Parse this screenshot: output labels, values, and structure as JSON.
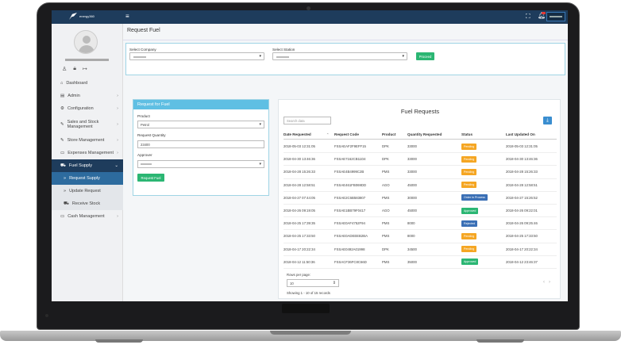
{
  "colors": {
    "topbar": "#1e3c5c",
    "accent_green": "#2bb673",
    "form_header": "#5fbfe3",
    "active_nav": "#2d6b9e"
  },
  "topbar": {
    "brand": "energy360",
    "menu_icon": "hamburger-icon",
    "expand_icon": "expand-icon",
    "bell_icon": "bell-icon"
  },
  "sidebar": {
    "icons": [
      "user-icon",
      "lock-icon",
      "logout-icon"
    ],
    "items": [
      {
        "label": "Dashboard",
        "icon": "home-icon"
      },
      {
        "label": "Admin",
        "icon": "table-icon",
        "chevron": "›"
      },
      {
        "label": "Configuration",
        "icon": "gear-icon",
        "chevron": "›"
      },
      {
        "label": "Sales and Stock Management",
        "icon": "pencil-icon",
        "chevron": "›"
      },
      {
        "label": "Store Management",
        "icon": "pencil-icon",
        "chevron": "›"
      },
      {
        "label": "Expenses Management",
        "icon": "money-icon",
        "chevron": "›"
      },
      {
        "label": "Fuel Supply",
        "icon": "truck-icon",
        "chevron": "⌄"
      },
      {
        "label": "Request Supply",
        "icon": "arrow-icon"
      },
      {
        "label": "Update Request",
        "icon": "arrow-icon"
      },
      {
        "label": "Receive Stock",
        "icon": "truck-icon"
      },
      {
        "label": "Cash Management",
        "icon": "money-icon",
        "chevron": "›"
      }
    ]
  },
  "page": {
    "title": "Request Fuel"
  },
  "selectors": {
    "company_label": "Select Company",
    "station_label": "Select Station",
    "proceed_label": "Proceed"
  },
  "form": {
    "header": "Request for Fuel",
    "product_label": "Product",
    "product_value": "Petrol",
    "quantity_label": "Request Quantity",
    "quantity_value": "23400",
    "approver_label": "Approver",
    "submit_label": "Request Fuel"
  },
  "table": {
    "title": "Fuel Requests",
    "search_placeholder": "Search data",
    "download_icon": "download-icon",
    "headers": [
      "Date Requested",
      "Request Code",
      "Product",
      "Quantity Requested",
      "Status",
      "Last Updated On"
    ],
    "rows": [
      [
        "2018-05-03 12:31:05",
        "FSSAEAF2F9EFF15",
        "DPK",
        "33000",
        "Pending",
        "2018-05-03 12:31:05"
      ],
      [
        "2018-04-30 13:46:36",
        "FSSAE7162CB11D4",
        "DPK",
        "33000",
        "Pending",
        "2018-04-30 13:46:36"
      ],
      [
        "2018-04-28 15:26:33",
        "FSSAE4B4999C2B",
        "PMS",
        "33000",
        "Pending",
        "2018-04-28 15:26:33"
      ],
      [
        "2018-04-28 12:58:51",
        "FSSAE461FB069DD",
        "AGO",
        "45000",
        "Pending",
        "2018-04-28 12:58:51"
      ],
      [
        "2018-04-27 07:44:05",
        "FSSAE2C6B583807",
        "PMS",
        "30000",
        "Order in Process",
        "2018-04-27 15:26:52"
      ],
      [
        "2018-04-26 09:19:05",
        "FSSAE1BB79F0417",
        "AGO",
        "45000",
        "Approved",
        "2018-04-26 09:22:01"
      ],
      [
        "2018-04-25 17:39:35",
        "FSSAE0AF4752F94",
        "PMS",
        "8000",
        "Rejected",
        "2018-04-26 09:25:46"
      ],
      [
        "2018-04-25 17:33:50",
        "FSSAE0ADEEEB2BA",
        "PMS",
        "8000",
        "Pending",
        "2018-04-25 17:33:50"
      ],
      [
        "2018-04-17 20:22:34",
        "FSSAE0492A01998",
        "DPK",
        "34500",
        "Pending",
        "2018-04-17 20:22:34"
      ],
      [
        "2018-04-12 11:50:36",
        "FSSACF36FC8C66D",
        "PMS",
        "35000",
        "Approved",
        "2018-04-12 23:46:37"
      ]
    ],
    "status_colors": {
      "Pending": "#f5a623",
      "Order in Process": "#3a6fb5",
      "Approved": "#2bb673",
      "Rejected": "#3a6fb5"
    },
    "rows_per_page_label": "Rows per page:",
    "rows_per_page_value": "10",
    "showing_text": "Showing 1 - 10 of 15 records"
  }
}
